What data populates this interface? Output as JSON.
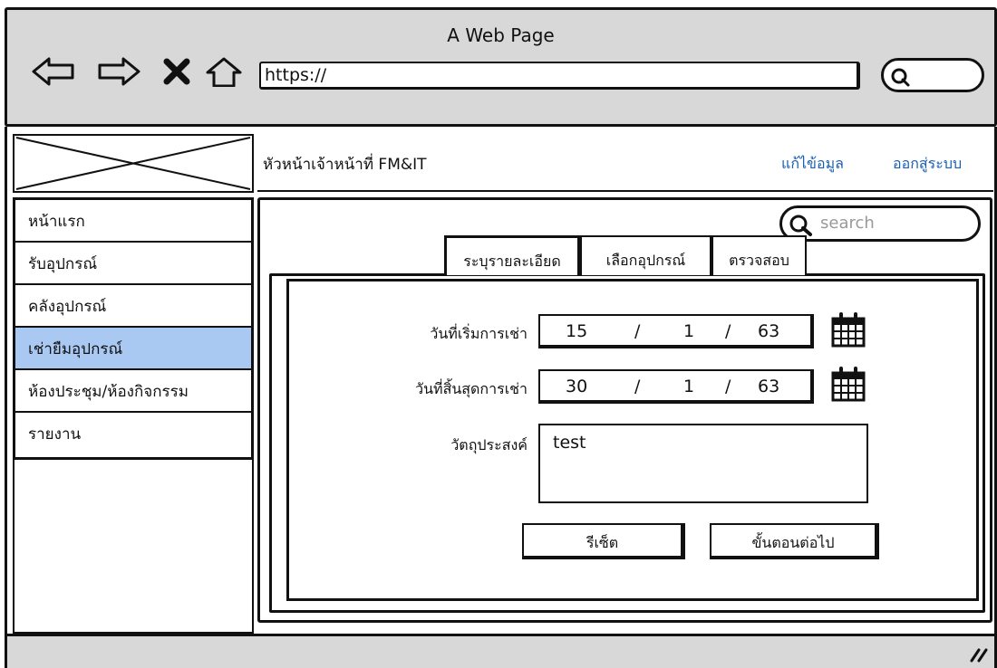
{
  "browser": {
    "window_title": "A Web Page",
    "url": "https://"
  },
  "header": {
    "title": "หัวหน้าเจ้าหน้าที่ FM&IT",
    "links": {
      "edit_profile": "แก้ไข้อมูล",
      "logout": "ออกสู่ระบบ"
    }
  },
  "sidebar": {
    "items": [
      {
        "label": "หน้าแรก",
        "active": false
      },
      {
        "label": "รับอุปกรณ์",
        "active": false
      },
      {
        "label": "คลังอุปกรณ์",
        "active": false
      },
      {
        "label": "เช่ายืมอุปกรณ์",
        "active": true
      },
      {
        "label": "ห้องประชุม/ห้องกิจกรรม",
        "active": false
      },
      {
        "label": "รายงาน",
        "active": false
      }
    ]
  },
  "search": {
    "placeholder": "search"
  },
  "tabs": [
    {
      "label": "ระบุรายละเอียด",
      "active": true
    },
    {
      "label": "เลือกอุปกรณ์",
      "active": false
    },
    {
      "label": "ตรวจสอบ",
      "active": false
    }
  ],
  "form": {
    "start_date": {
      "label": "วันที่เริ่มการเช่า",
      "day": "15",
      "month": "1",
      "year": "63",
      "separator": "/"
    },
    "end_date": {
      "label": "วันที่สิ้นสุดการเช่า",
      "day": "30",
      "month": "1",
      "year": "63",
      "separator": "/"
    },
    "purpose": {
      "label": "วัตถุประสงค์",
      "value": "test"
    }
  },
  "buttons": {
    "reset": "รีเซ็ต",
    "next": "ขั้นตอนต่อไป"
  },
  "colors": {
    "active_menu": "#a9c9f3",
    "link": "#1b5fb3",
    "chrome": "#d8d8d8"
  },
  "icons": [
    "back-arrow-icon",
    "forward-arrow-icon",
    "close-icon",
    "home-icon",
    "search-icon",
    "calendar-icon",
    "resize-grip-icon",
    "image-placeholder-icon"
  ]
}
